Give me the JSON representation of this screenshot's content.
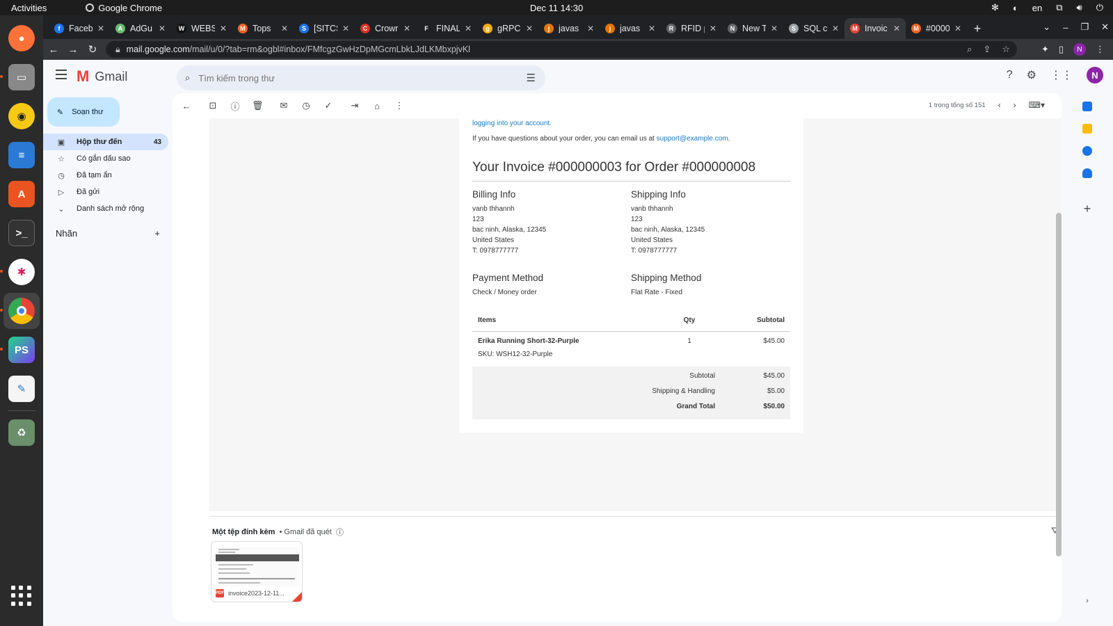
{
  "os": {
    "activities": "Activities",
    "app_name": "Google Chrome",
    "clock": "Dec 11  14:30",
    "lang": "en"
  },
  "tabs": [
    {
      "label": "Faceb",
      "color": "#1877f2",
      "glyph": "f"
    },
    {
      "label": "AdGu",
      "color": "#68bc71",
      "glyph": "A"
    },
    {
      "label": "WEBS",
      "color": "#111111",
      "glyph": "W"
    },
    {
      "label": "Tops",
      "color": "#f26322",
      "glyph": "M"
    },
    {
      "label": "[SITCS",
      "color": "#1a73e8",
      "glyph": "S"
    },
    {
      "label": "Crowr",
      "color": "#d93025",
      "glyph": "C"
    },
    {
      "label": "FINAL",
      "color": "#202124",
      "glyph": "F"
    },
    {
      "label": "gRPC",
      "color": "#f9ab00",
      "glyph": "g"
    },
    {
      "label": "javas",
      "color": "#e37400",
      "glyph": "j"
    },
    {
      "label": "javas",
      "color": "#e37400",
      "glyph": "j"
    },
    {
      "label": "RFID p",
      "color": "#5f6368",
      "glyph": "R"
    },
    {
      "label": "New T",
      "color": "#5f6368",
      "glyph": "N"
    },
    {
      "label": "SQL c",
      "color": "#9aa0a6",
      "glyph": "S"
    },
    {
      "label": "Invoic",
      "color": "#ea4335",
      "glyph": "M"
    },
    {
      "label": "#0000",
      "color": "#f26322",
      "glyph": "M"
    }
  ],
  "url": {
    "host": "mail.google.com",
    "path": "/mail/u/0/?tab=rm&ogbl#inbox/FMfcgzGwHzDpMGcmLbkLJdLKMbxpjvKl"
  },
  "gmail": {
    "brand": "Gmail",
    "search_placeholder": "Tìm kiếm trong thư",
    "avatar_letter": "N",
    "compose_label": "Soạn thư",
    "nav": [
      {
        "label": "Hộp thư đến",
        "count": "43"
      },
      {
        "label": "Có gắn dấu sao"
      },
      {
        "label": "Đã tạm ẩn"
      },
      {
        "label": "Đã gửi"
      },
      {
        "label": "Danh sách mở rộng"
      }
    ],
    "labels_heading": "Nhãn",
    "pager_text": "1 trong tổng số 151"
  },
  "email": {
    "login_line": "logging into your account.",
    "questions_prefix": "If you have questions about your order, you can email us at",
    "support_email": "support@example.com",
    "title": "Your Invoice #000000003 for Order #000000008",
    "billing": {
      "heading": "Billing Info",
      "name": "vanb thhannh",
      "street": "123",
      "city_line": "bac ninh, Alaska, 12345",
      "country": "United States",
      "phone": "T: 0978777777"
    },
    "shipping": {
      "heading": "Shipping Info",
      "name": "vanb thhannh",
      "street": "123",
      "city_line": "bac ninh, Alaska, 12345",
      "country": "United States",
      "phone": "T: 0978777777"
    },
    "payment": {
      "heading": "Payment Method",
      "value": "Check / Money order"
    },
    "shipping_method": {
      "heading": "Shipping Method",
      "value": "Flat Rate - Fixed"
    },
    "items_table": {
      "headers": {
        "items": "Items",
        "qty": "Qty",
        "subtotal": "Subtotal"
      },
      "rows": [
        {
          "name": "Erika Running Short-32-Purple",
          "sku": "SKU: WSH12-32-Purple",
          "qty": "1",
          "subtotal": "$45.00"
        }
      ]
    },
    "totals": {
      "subtotal_label": "Subtotal",
      "subtotal_value": "$45.00",
      "shipping_label": "Shipping & Handling",
      "shipping_value": "$5.00",
      "grand_label": "Grand Total",
      "grand_value": "$50.00"
    }
  },
  "attachment": {
    "heading": "Một tệp đính kèm",
    "scanned": "• Gmail đã quét",
    "filename": "invoice2023-12-11...",
    "badge": "PDF"
  }
}
